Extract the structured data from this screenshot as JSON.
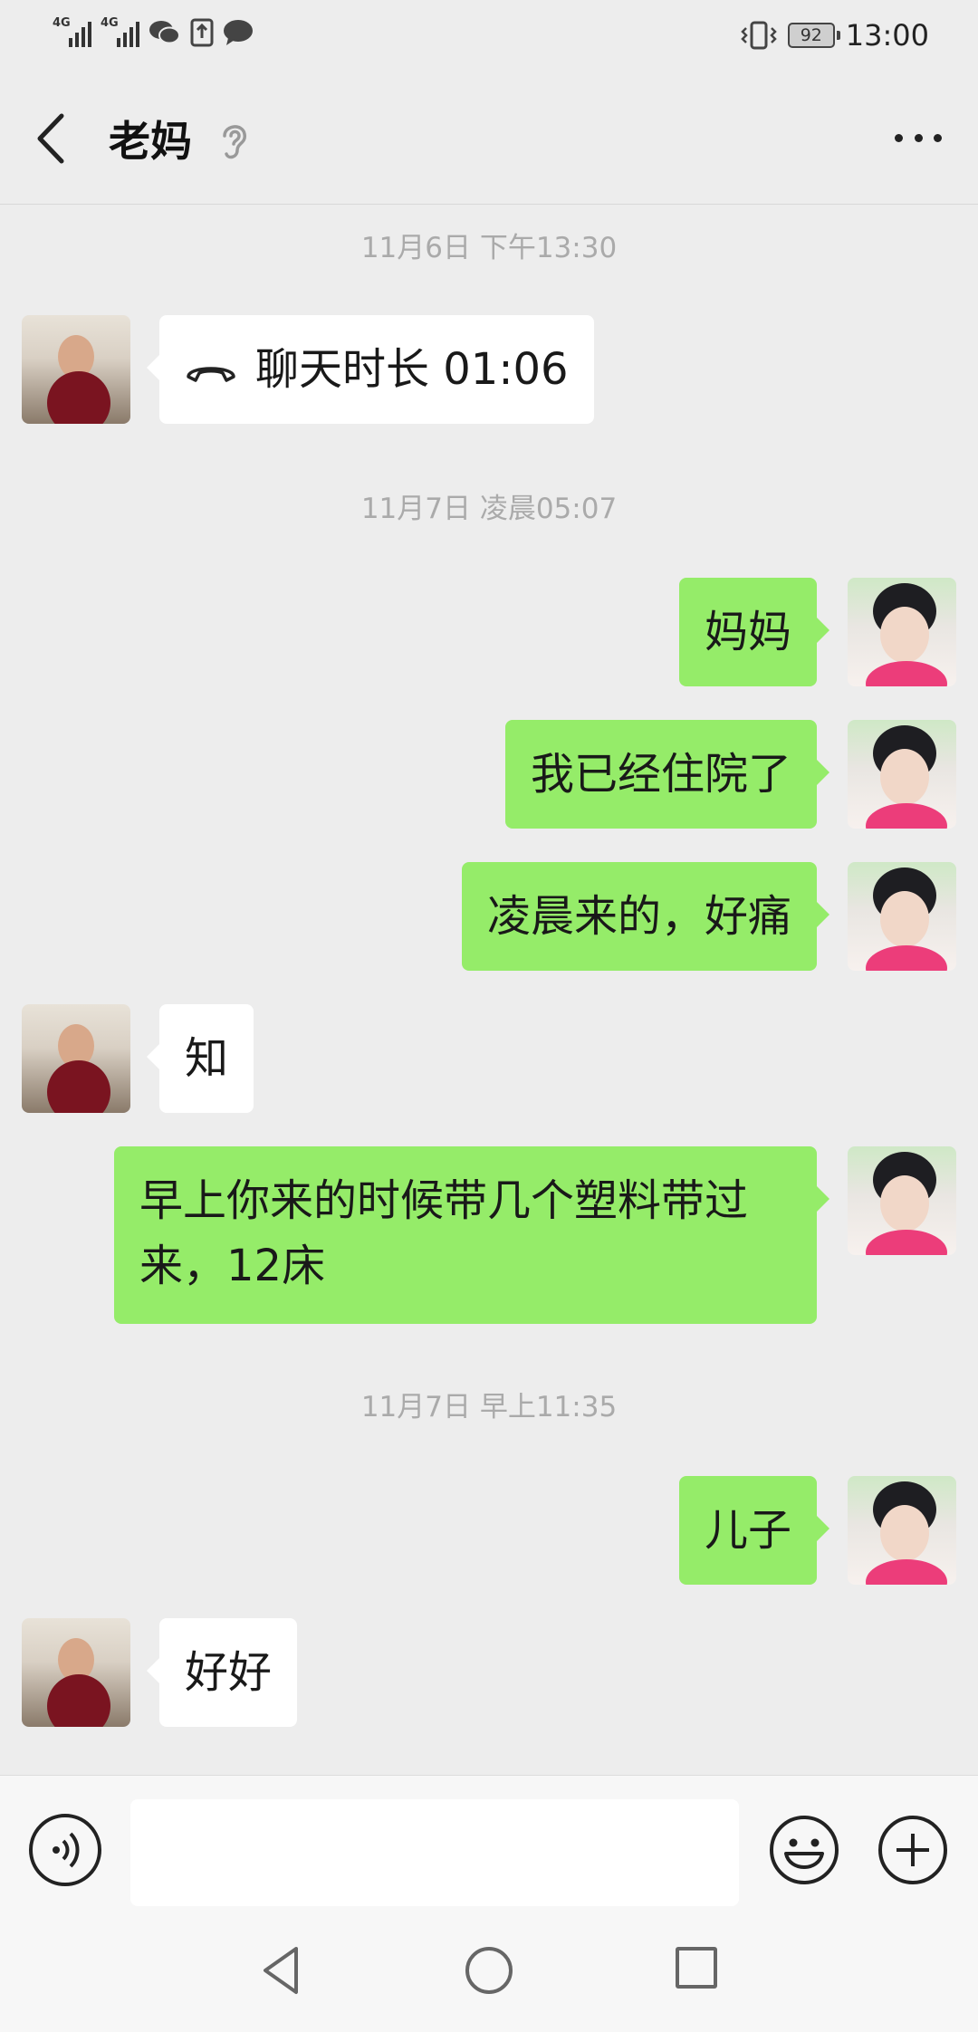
{
  "status_bar": {
    "network_1": "4G",
    "network_2": "4G",
    "battery": "92",
    "time": "13:00"
  },
  "header": {
    "title": "老妈",
    "back_icon": "chevron-left-icon",
    "mode_icon": "ear-icon",
    "more_icon": "more-dots-icon"
  },
  "timestamps": [
    "11月6日 下午13:30",
    "11月7日 凌晨05:07",
    "11月7日 早上11:35"
  ],
  "messages": [
    {
      "side": "left",
      "text": "聊天时长 01:06",
      "icon": "phone-hangup-icon"
    },
    {
      "side": "right",
      "text": "妈妈"
    },
    {
      "side": "right",
      "text": "我已经住院了"
    },
    {
      "side": "right",
      "text": "凌晨来的，好痛"
    },
    {
      "side": "left",
      "text": "知"
    },
    {
      "side": "right",
      "text_line1": "早上你来的时候带几个塑料带过",
      "text_line2": "来，12床"
    },
    {
      "side": "right",
      "text": "儿子"
    },
    {
      "side": "left",
      "text": "好好"
    }
  ],
  "input_bar": {
    "placeholder": "",
    "voice_icon": "voice-icon",
    "emoji_icon": "emoji-icon",
    "plus_icon": "plus-icon"
  },
  "colors": {
    "background": "#ededed",
    "bubble_self": "#95ec69",
    "bubble_other": "#ffffff",
    "timestamp": "#aaaaaa"
  }
}
